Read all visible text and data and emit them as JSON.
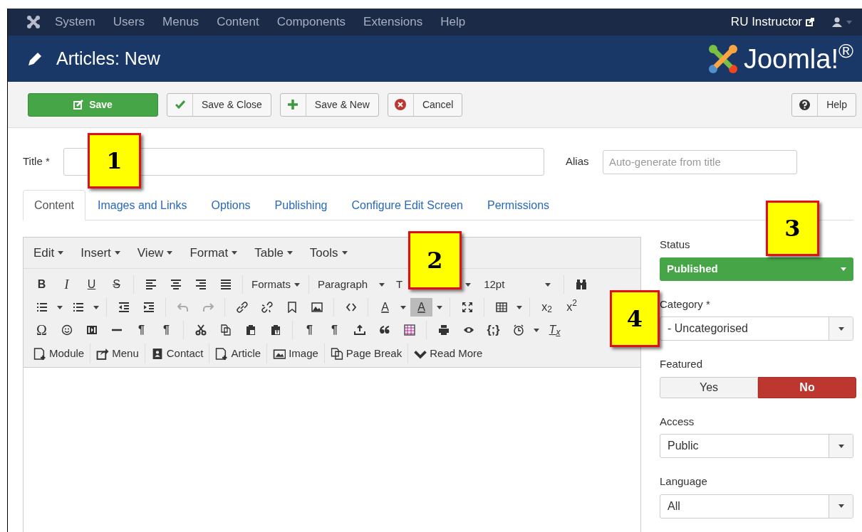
{
  "nav": {
    "menus": [
      "System",
      "Users",
      "Menus",
      "Content",
      "Components",
      "Extensions",
      "Help"
    ],
    "user": "RU Instructor"
  },
  "header": {
    "title": "Articles: New",
    "brand": "Joomla!$^{®}$"
  },
  "actions": [
    {
      "kind": "primary",
      "label": "Save"
    },
    {
      "kind": "check",
      "label": "Save & Close"
    },
    {
      "kind": "plus",
      "label": "Save & New"
    },
    {
      "kind": "cancel",
      "label": "Cancel"
    },
    {
      "kind": "help",
      "label": "Help"
    }
  ],
  "title_field": {
    "label": "Title *"
  },
  "alias_field": {
    "label": "Alias",
    "placeholder": "Auto-generate from title"
  },
  "tabs": [
    {
      "label": "Content",
      "selected": true
    },
    {
      "label": "Images and Links",
      "selected": false
    },
    {
      "label": "Options",
      "selected": false
    },
    {
      "label": "Publishing",
      "selected": false
    },
    {
      "label": "Configure Edit Screen",
      "selected": false
    },
    {
      "label": "Permissions",
      "selected": false
    }
  ],
  "editor": {
    "menus": [
      "Edit",
      "Insert",
      "View",
      "Format",
      "Table",
      "Tools"
    ],
    "glyphs": [
      "B",
      "I",
      "U",
      "S",
      "A",
      "A",
      "x$_{2}$",
      "x$^{2}$",
      "Ω",
      "¶",
      "¶",
      "¶",
      "¶",
      "{;}",
      "T$_{x}$"
    ],
    "selects": [
      "Formats",
      "Paragraph",
      "T",
      "12pt"
    ],
    "insert_buttons": [
      "Module",
      "Menu",
      "Contact",
      "Article",
      "Image",
      "Page Break",
      "Read More"
    ]
  },
  "sidebar": [
    {
      "kind": "status",
      "label": "Status",
      "value": "Published"
    },
    {
      "kind": "select",
      "label": "Category *",
      "value": "- Uncategorised"
    },
    {
      "kind": "toggle",
      "label": "Featured",
      "options": [
        {
          "label": "Yes",
          "selected": false
        },
        {
          "label": "No",
          "selected": true
        }
      ]
    },
    {
      "kind": "select",
      "label": "Access",
      "value": "Public"
    },
    {
      "kind": "select",
      "label": "Language",
      "value": "All"
    }
  ],
  "callouts": [
    "1",
    "2",
    "3",
    "4"
  ]
}
